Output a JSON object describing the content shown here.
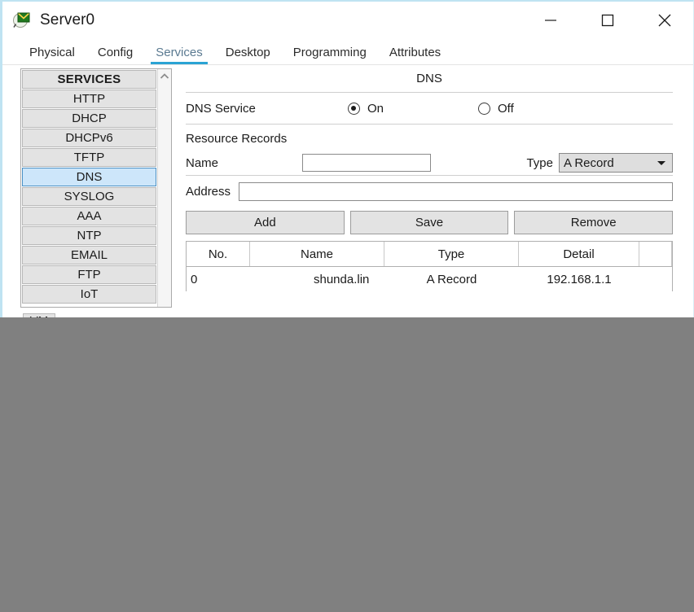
{
  "window": {
    "title": "Server0",
    "icon": "server-magnifier-icon",
    "minimize_label": "—",
    "maximize_label": "□",
    "close_label": "✕"
  },
  "tabs": [
    {
      "label": "Physical",
      "active": false
    },
    {
      "label": "Config",
      "active": false
    },
    {
      "label": "Services",
      "active": true
    },
    {
      "label": "Desktop",
      "active": false
    },
    {
      "label": "Programming",
      "active": false
    },
    {
      "label": "Attributes",
      "active": false
    }
  ],
  "sidebar": {
    "header": "SERVICES",
    "items": [
      {
        "label": "HTTP",
        "selected": false
      },
      {
        "label": "DHCP",
        "selected": false
      },
      {
        "label": "DHCPv6",
        "selected": false
      },
      {
        "label": "TFTP",
        "selected": false
      },
      {
        "label": "DNS",
        "selected": true
      },
      {
        "label": "SYSLOG",
        "selected": false
      },
      {
        "label": "AAA",
        "selected": false
      },
      {
        "label": "NTP",
        "selected": false
      },
      {
        "label": "EMAIL",
        "selected": false
      },
      {
        "label": "FTP",
        "selected": false
      },
      {
        "label": "IoT",
        "selected": false
      }
    ],
    "clipped_item": "VM"
  },
  "panel": {
    "title": "DNS",
    "service_label": "DNS Service",
    "radio_on_label": "On",
    "radio_off_label": "Off",
    "service_state": "On",
    "section_title": "Resource Records",
    "name_label": "Name",
    "name_value": "",
    "name_placeholder": "",
    "type_label": "Type",
    "type_value": "A Record",
    "address_label": "Address",
    "address_value": "",
    "address_placeholder": "",
    "buttons": {
      "add": "Add",
      "save": "Save",
      "remove": "Remove"
    },
    "table": {
      "columns": [
        "No.",
        "Name",
        "Type",
        "Detail"
      ],
      "rows": [
        {
          "no": "0",
          "name": "shunda.lin",
          "type": "A Record",
          "detail": "192.168.1.1"
        }
      ]
    }
  },
  "colors": {
    "accent": "#2ba3d4",
    "selection": "#cde6fa",
    "selection_border": "#4a90c4",
    "window_border": "#bfe3f2",
    "desktop": "#808080"
  }
}
